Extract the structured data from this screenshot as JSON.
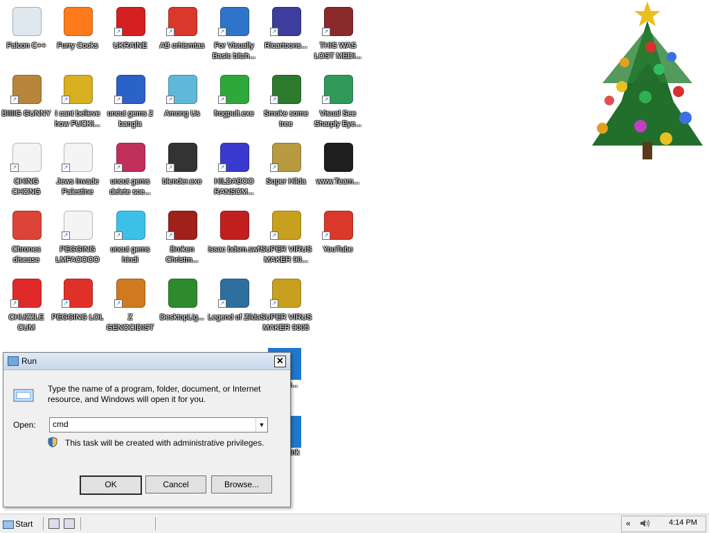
{
  "desktop": {
    "icons": [
      {
        "label": "Falcon C++",
        "icon": "recycle-bin-icon",
        "color": "#dfe7ef",
        "shortcut": false
      },
      {
        "label": "Furry Cocks",
        "icon": "firefox-icon",
        "color": "#ff7a1a",
        "shortcut": false
      },
      {
        "label": "UKRAINE",
        "icon": "radiation-icon",
        "color": "#d42020",
        "shortcut": true
      },
      {
        "label": "AB crhismtas",
        "icon": "angry-bird-icon",
        "color": "#d9382b",
        "shortcut": true
      },
      {
        "label": "For Visually Basic bitch...",
        "icon": "vb-icon",
        "color": "#2e74c9",
        "shortcut": true
      },
      {
        "label": "Ricartoons...",
        "icon": "cartoon-character-icon",
        "color": "#3d3d9e",
        "shortcut": true
      },
      {
        "label": "THIS WAS LOST MEDI...",
        "icon": "color-blocks-icon",
        "color": "#8a2a2a",
        "shortcut": true
      },
      {
        "label": "BIIIIG GUNNY",
        "icon": "money-bag-icon",
        "color": "#b8863a",
        "shortcut": true
      },
      {
        "label": "I cant believe how FUCKI...",
        "icon": "cpp-hat-icon",
        "color": "#d8b020",
        "shortcut": true
      },
      {
        "label": "uncut gems 2  bangla",
        "icon": "gem-2-icon",
        "color": "#2a62c8",
        "shortcut": true
      },
      {
        "label": "Among Us",
        "icon": "among-us-icon",
        "color": "#5fb8d8",
        "shortcut": true
      },
      {
        "label": "frogpult.exe",
        "icon": "frog-icon",
        "color": "#2fa83a",
        "shortcut": true
      },
      {
        "label": "Smoke some tree",
        "icon": "xmas-tree-icon",
        "color": "#2d7a2d",
        "shortcut": true
      },
      {
        "label": "Visual See Sharply Eye...",
        "icon": "csharp-icon",
        "color": "#2f9a5a",
        "shortcut": true
      },
      {
        "label": "CHING CHONG",
        "icon": "blank-file-icon",
        "color": "#f4f4f4",
        "shortcut": true
      },
      {
        "label": "Jews Invade Palestine",
        "icon": "blank-file-icon",
        "color": "#f4f4f4",
        "shortcut": true
      },
      {
        "label": "uncut gems delete sce...",
        "icon": "gem-icon",
        "color": "#c0305a",
        "shortcut": true
      },
      {
        "label": "blender.exe",
        "icon": "pixel-tool-icon",
        "color": "#333333",
        "shortcut": true
      },
      {
        "label": "HILDABOO RANSOM...",
        "icon": "wg-script-icon",
        "color": "#3a3ad0",
        "shortcut": true
      },
      {
        "label": "Super Hilda",
        "icon": "pixel-face-icon",
        "color": "#b89a40",
        "shortcut": true
      },
      {
        "label": "www.Team...",
        "icon": "dark-device-icon",
        "color": "#1e1e1e",
        "shortcut": false
      },
      {
        "label": "Chrones disease",
        "icon": "chrome-icon",
        "color": "#db4437",
        "shortcut": false
      },
      {
        "label": "PEGGING LMFAOOOO",
        "icon": "blank-file-icon",
        "color": "#f4f4f4",
        "shortcut": true
      },
      {
        "label": "uncut gems hindi",
        "icon": "diamond-icon",
        "color": "#3cc0e8",
        "shortcut": true
      },
      {
        "label": "Broken Christm...",
        "icon": "ornament-icon",
        "color": "#a0201a",
        "shortcut": true
      },
      {
        "label": "issac bdsm.swf",
        "icon": "swf-file-icon",
        "color": "#c02020",
        "shortcut": false
      },
      {
        "label": "SUPER VIRUS MAKER 90...",
        "icon": "camera-icon",
        "color": "#c8a020",
        "shortcut": true
      },
      {
        "label": "YouTube",
        "icon": "angry-bird-icon",
        "color": "#d9382b",
        "shortcut": true
      },
      {
        "label": "CHUZZLE CUM",
        "icon": "chuzzle-icon",
        "color": "#e02a2a",
        "shortcut": true
      },
      {
        "label": "PEGGING LOL",
        "icon": "p-logo-icon",
        "color": "#e0302a",
        "shortcut": true
      },
      {
        "label": "Z GENOCIDIST",
        "icon": "blocks-icon",
        "color": "#d07a20",
        "shortcut": true
      },
      {
        "label": "DesktopLig...",
        "icon": "star-tree-icon",
        "color": "#2d8a2d",
        "shortcut": false
      },
      {
        "label": "Legend of Zilda",
        "icon": "zilda-icon",
        "color": "#2f6fa0",
        "shortcut": true
      },
      {
        "label": "SUPER VIRUS MAKER 9005",
        "icon": "camera-icon",
        "color": "#c8a020",
        "shortcut": true
      }
    ],
    "partial_icons": [
      {
        "label": "OS o...",
        "icon": "gear-icon",
        "color": "#1e78d0"
      },
      {
        "label": "OS Link",
        "icon": "gear-icon",
        "color": "#1e78d0"
      }
    ]
  },
  "run_dialog": {
    "title": "Run",
    "close_label": "✕",
    "description": "Type the name of a program, folder, document, or Internet resource, and Windows will open it for you.",
    "open_label": "Open:",
    "open_value": "cmd",
    "admin_note": "This task will be created with administrative privileges.",
    "buttons": {
      "ok": "OK",
      "cancel": "Cancel",
      "browse": "Browse..."
    }
  },
  "taskbar": {
    "start_label": "Start",
    "tray_chevron": "«",
    "clock": "4:14 PM"
  }
}
